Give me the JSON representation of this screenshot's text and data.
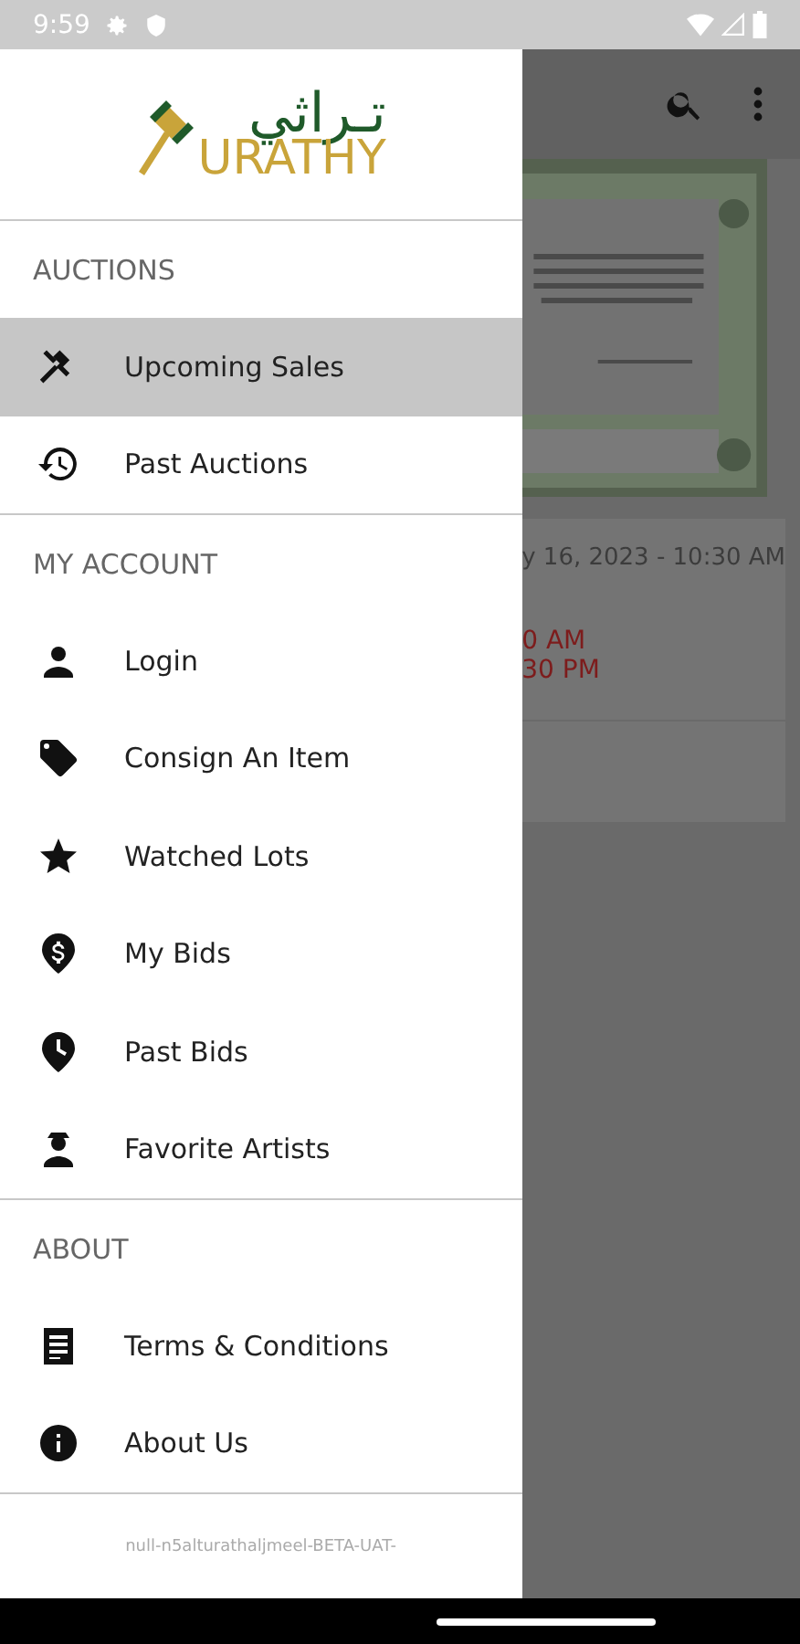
{
  "status_bar": {
    "time": "9:59"
  },
  "drawer": {
    "logo": {
      "arabic": "تـراثي",
      "latin": "URATHY"
    },
    "sections": [
      {
        "title": "AUCTIONS",
        "items": [
          {
            "label": "Upcoming Sales",
            "kind": "gavel",
            "selected": true
          },
          {
            "label": "Past Auctions",
            "kind": "history",
            "selected": false
          }
        ]
      },
      {
        "title": "MY ACCOUNT",
        "items": [
          {
            "label": "Login",
            "kind": "person",
            "selected": false
          },
          {
            "label": "Consign An Item",
            "kind": "tag",
            "selected": false
          },
          {
            "label": "Watched Lots",
            "kind": "star",
            "selected": false
          },
          {
            "label": "My Bids",
            "kind": "dollar-pin",
            "selected": false
          },
          {
            "label": "Past Bids",
            "kind": "clock-pin",
            "selected": false
          },
          {
            "label": "Favorite Artists",
            "kind": "artist",
            "selected": false
          }
        ]
      },
      {
        "title": "ABOUT",
        "items": [
          {
            "label": "Terms & Conditions",
            "kind": "document",
            "selected": false
          },
          {
            "label": "About Us",
            "kind": "info",
            "selected": false
          }
        ]
      }
    ],
    "footer": "null-n5alturathaljmeel-BETA-UAT-"
  },
  "background": {
    "card": {
      "date": "y 16, 2023 - 10:30 AM",
      "start": "0 AM",
      "end": "30 PM"
    }
  }
}
